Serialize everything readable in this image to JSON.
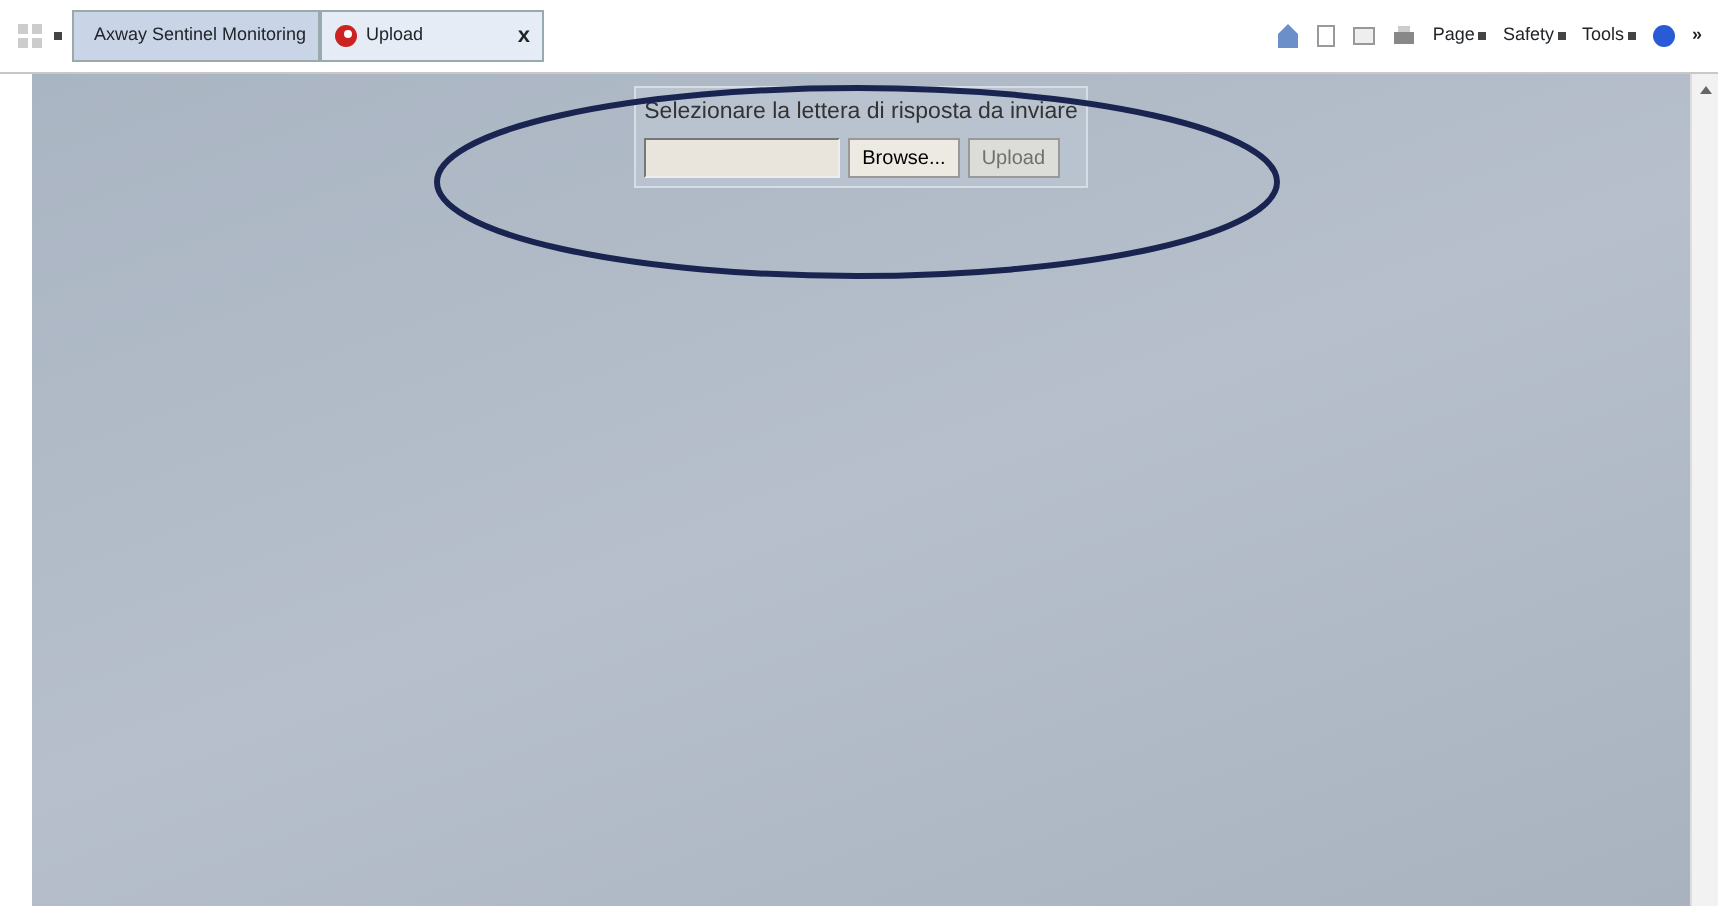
{
  "tabs": [
    {
      "label": "Axway Sentinel Monitoring",
      "selected": false
    },
    {
      "label": "Upload",
      "selected": true,
      "close": "x"
    }
  ],
  "toolbar": [
    {
      "label": "Page"
    },
    {
      "label": "Safety"
    },
    {
      "label": "Tools"
    }
  ],
  "more": "»",
  "form": {
    "prompt": "Selezionare la lettera di risposta da inviare",
    "buttons": [
      {
        "label": "Browse...",
        "disabled": false
      },
      {
        "label": "Upload",
        "disabled": true
      }
    ]
  }
}
